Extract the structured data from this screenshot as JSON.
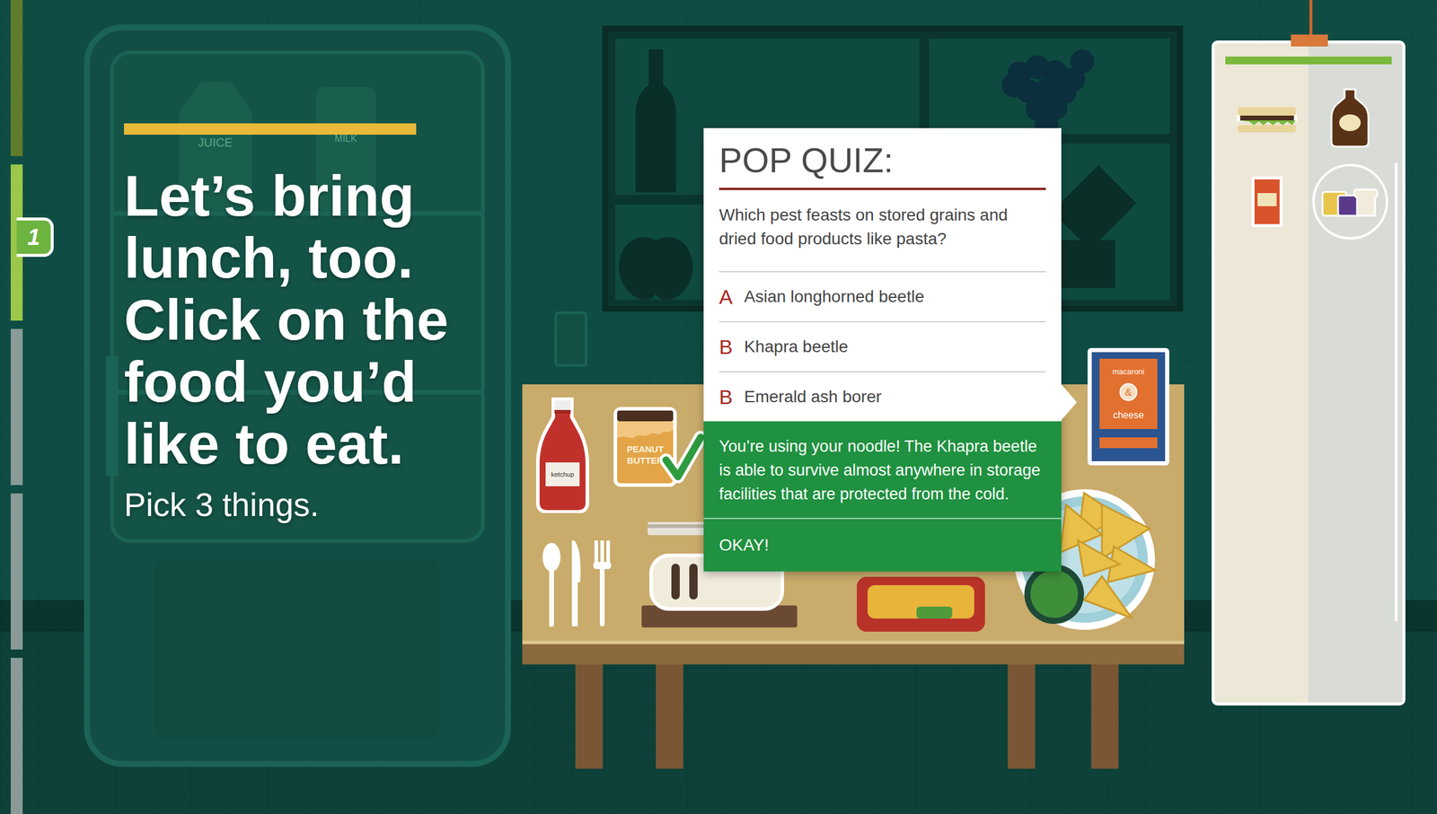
{
  "progress": {
    "badge": "1",
    "steps": [
      {
        "completed": true,
        "selected": false
      },
      {
        "completed": false,
        "selected": true
      },
      {
        "completed": false,
        "selected": false
      },
      {
        "completed": false,
        "selected": false
      },
      {
        "completed": false,
        "selected": false
      }
    ]
  },
  "instruction": {
    "heading_lines": [
      "Let’s bring",
      "lunch, too.",
      "Click on the",
      "food you’d",
      "like to eat."
    ],
    "subheading": "Pick 3 things."
  },
  "fridge": {
    "labels": [
      "JUICE",
      "MILK"
    ]
  },
  "table_items": [
    {
      "kind": "ketchup",
      "labels": [
        "ketchup"
      ],
      "checked": false
    },
    {
      "kind": "peanut-butter",
      "labels": [
        "PEANUT",
        "BUTTER"
      ],
      "checked": true
    },
    {
      "kind": "mac-and-cheese",
      "labels": [
        "macaroni",
        "&",
        "cheese"
      ],
      "checked": false
    },
    {
      "kind": "cutlery",
      "labels": [],
      "checked": false
    },
    {
      "kind": "bread",
      "labels": [],
      "checked": false
    },
    {
      "kind": "tray",
      "labels": [],
      "checked": false
    },
    {
      "kind": "chips",
      "labels": [],
      "checked": false
    }
  ],
  "quiz": {
    "title": "POP QUIZ:",
    "question": "Which pest feasts on stored grains and dried food products like pasta?",
    "options": [
      {
        "letter": "A",
        "text": "Asian longhorned beetle"
      },
      {
        "letter": "B",
        "text": "Khapra beetle"
      },
      {
        "letter": "B",
        "text": "Emerald ash borer"
      }
    ],
    "feedback": "You’re using your noodle! The Khapra beetle is able to survive almost anywhere in storage facilities that are protected from the cold.",
    "button": "OKAY!"
  },
  "lunchbox": {
    "items": [
      {
        "kind": "sandwich",
        "selected": false
      },
      {
        "kind": "syrup",
        "selected": false
      },
      {
        "kind": "snack",
        "selected": false
      },
      {
        "kind": "bread-cheese",
        "selected": true
      }
    ]
  }
}
